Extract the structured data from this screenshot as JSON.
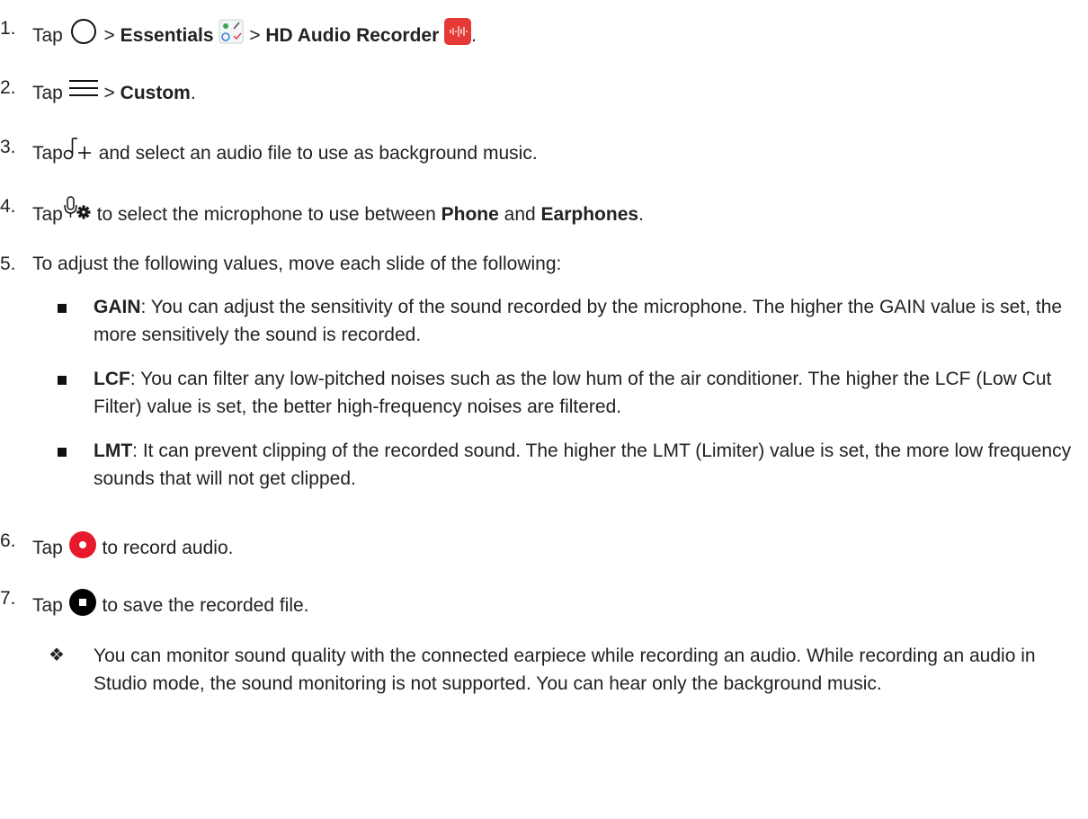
{
  "steps": [
    {
      "num": "1.",
      "tap": "Tap",
      "sep1": ">",
      "essentials": "Essentials",
      "sep2": ">",
      "app": "HD Audio Recorder",
      "end": "."
    },
    {
      "num": "2.",
      "tap": "Tap",
      "sep": ">",
      "custom": "Custom",
      "end": "."
    },
    {
      "num": "3.",
      "tap": "Tap",
      "rest": "and select an audio file to use as background music."
    },
    {
      "num": "4.",
      "tap": "Tap",
      "rest": "to select the microphone to use between",
      "phone": "Phone",
      "and": "and",
      "earphones": "Earphones",
      "end": "."
    },
    {
      "num": "5.",
      "text": "To adjust the following values, move each slide of the following:"
    },
    {
      "num": "6.",
      "tap": "Tap",
      "rest": "to record audio."
    },
    {
      "num": "7.",
      "tap": "Tap",
      "rest": "to save the recorded file."
    }
  ],
  "sliders": [
    {
      "name": "GAIN",
      "desc": ": You can adjust the sensitivity of the sound recorded by the microphone. The higher the GAIN value is set, the more sensitively the sound is recorded."
    },
    {
      "name": "LCF",
      "desc": ": You can filter any low-pitched noises such as the low hum of the air conditioner. The higher the LCF (Low Cut Filter) value is set, the better high-frequency noises are filtered."
    },
    {
      "name": "LMT",
      "desc": ": It can prevent clipping of the recorded sound. The higher the LMT (Limiter) value is set, the more low frequency sounds that will not get clipped."
    }
  ],
  "note": {
    "symbol": "❖",
    "text": "You can monitor sound quality with the connected earpiece while recording an audio. While recording an audio in Studio mode, the sound monitoring is not supported. You can hear only the background music."
  },
  "icons": {
    "home": "home-circle-icon",
    "essentials": "essentials-folder-icon",
    "recorder": "hd-audio-recorder-icon",
    "menu": "menu-icon",
    "add_music": "add-music-icon",
    "mic_settings": "mic-settings-icon",
    "record": "record-icon",
    "stop": "stop-icon"
  },
  "colors": {
    "text": "#222222",
    "record": "#e8192c",
    "recorder_app": "#e53935",
    "stop": "#000000"
  }
}
